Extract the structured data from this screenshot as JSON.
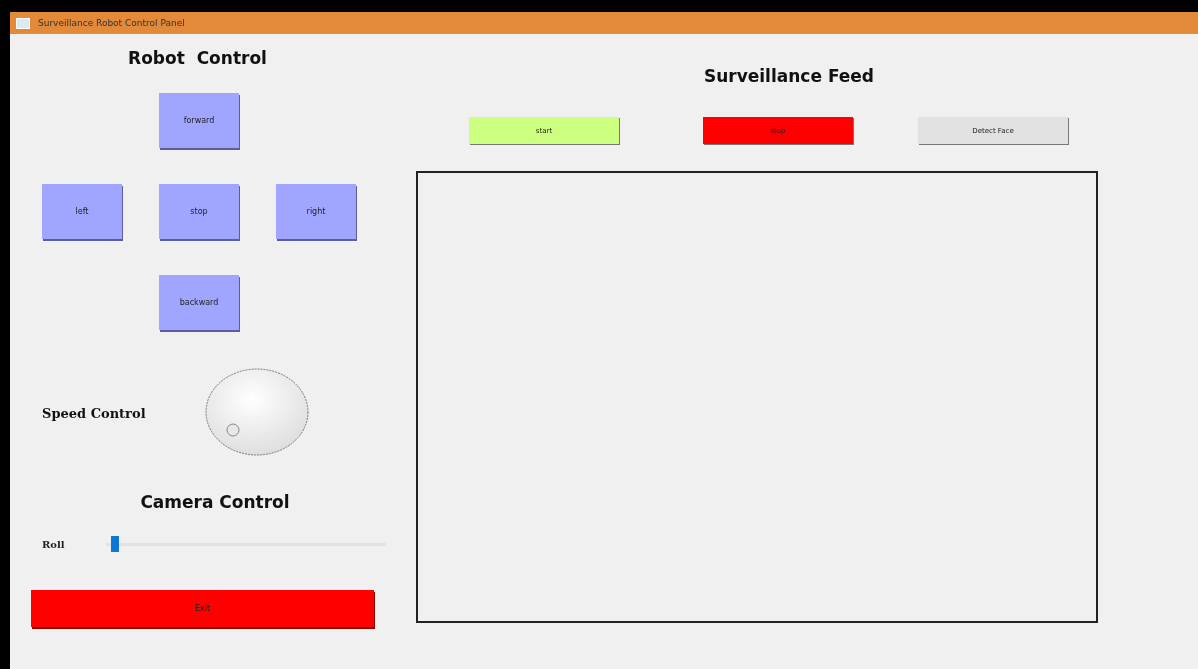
{
  "window": {
    "title": "Surveillance Robot Control Panel"
  },
  "robot_control": {
    "title": "Robot  Control",
    "buttons": [
      {
        "label": "forward",
        "kind": "up"
      },
      {
        "label": "left",
        "kind": "left"
      },
      {
        "label": "stop",
        "kind": "center"
      },
      {
        "label": "right",
        "kind": "right"
      },
      {
        "label": "backward",
        "kind": "down"
      }
    ]
  },
  "speed_control": {
    "label": "Speed Control"
  },
  "camera_control": {
    "title": "Camera Control",
    "sliders": [
      {
        "label": "Roll",
        "level": 0.02
      }
    ]
  },
  "exit_button": {
    "label": "Exit"
  },
  "surveillance_feed": {
    "title": "Surveillance Feed",
    "buttons": [
      {
        "label": "start",
        "color": "#ccff80"
      },
      {
        "label": "stop",
        "color": "#ff0000"
      },
      {
        "label": "Detect Face",
        "color": "#e1e1e1"
      }
    ]
  }
}
